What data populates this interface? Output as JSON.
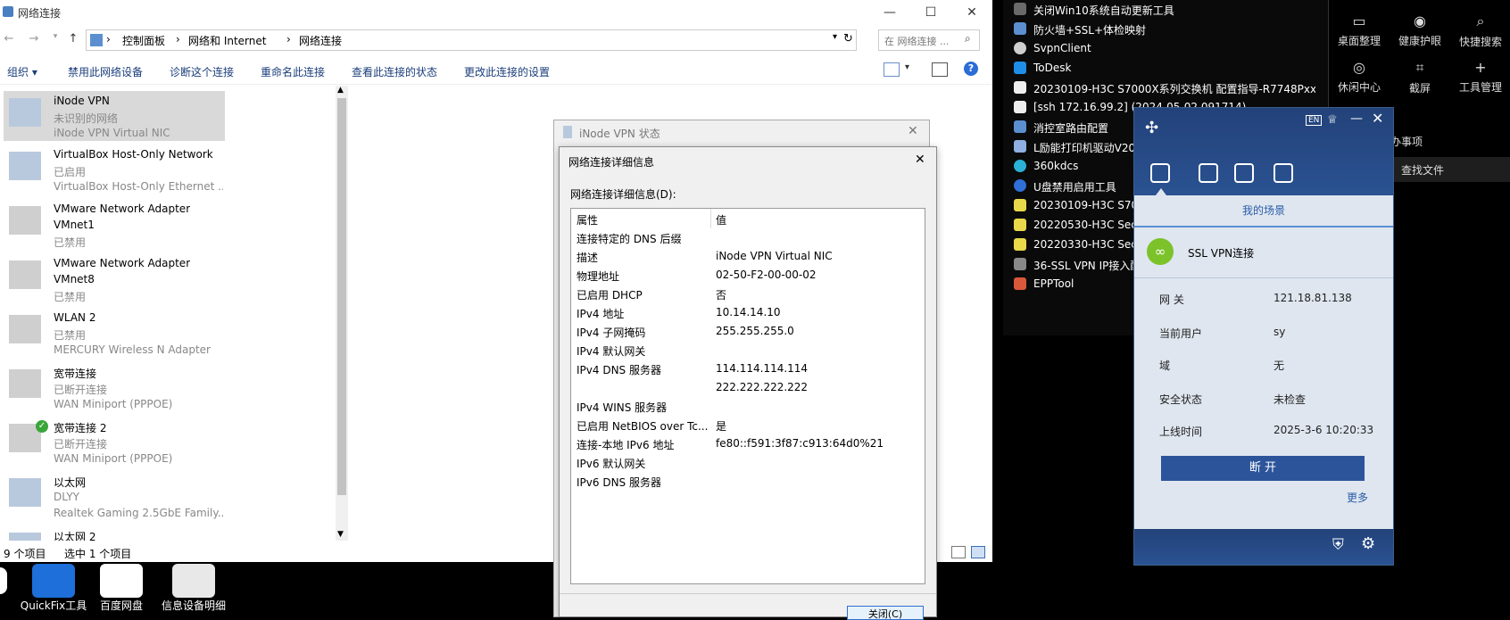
{
  "explorer": {
    "title": "网络连接",
    "breadcrumb": [
      "控制面板",
      "网络和 Internet",
      "网络连接"
    ],
    "search_placeholder": "在 网络连接 ...",
    "commands": [
      "组织 ▾",
      "禁用此网络设备",
      "诊断这个连接",
      "重命名此连接",
      "查看此连接的状态",
      "更改此连接的设置"
    ],
    "adapters": [
      {
        "name": "iNode VPN",
        "status": "未识别的网络",
        "device": "iNode VPN Virtual NIC"
      },
      {
        "name": "VirtualBox Host-Only Network",
        "status": "已启用",
        "device": "VirtualBox Host-Only Ethernet ..."
      },
      {
        "name": "VMware Network Adapter",
        "status": "VMnet1",
        "device": "已禁用"
      },
      {
        "name": "VMware Network Adapter",
        "status": "VMnet8",
        "device": "已禁用"
      },
      {
        "name": "WLAN 2",
        "status": "已禁用",
        "device": "MERCURY Wireless N Adapter"
      },
      {
        "name": "宽带连接",
        "status": "已断开连接",
        "device": "WAN Miniport (PPPOE)"
      },
      {
        "name": "宽带连接 2",
        "status": "已断开连接",
        "device": "WAN Miniport (PPPOE)"
      },
      {
        "name": "以太网",
        "status": "DLYY",
        "device": "Realtek Gaming 2.5GbE Family..."
      },
      {
        "name": "以太网 2",
        "status": "",
        "device": ""
      }
    ],
    "status_count": "9 个项目",
    "status_selected": "选中 1 个项目"
  },
  "taskbar": {
    "apps": [
      "QuickFix工具",
      "百度网盘",
      "信息设备明细"
    ]
  },
  "status_dialog": {
    "title": "iNode VPN 状态"
  },
  "detail_dialog": {
    "title": "网络连接详细信息",
    "label": "网络连接详细信息(D):",
    "col_prop": "属性",
    "col_val": "值",
    "rows": [
      {
        "k": "连接特定的 DNS 后缀",
        "v": ""
      },
      {
        "k": "描述",
        "v": "iNode VPN Virtual NIC"
      },
      {
        "k": "物理地址",
        "v": "02-50-F2-00-00-02"
      },
      {
        "k": "已启用 DHCP",
        "v": "否"
      },
      {
        "k": "IPv4 地址",
        "v": "10.14.14.10"
      },
      {
        "k": "IPv4 子网掩码",
        "v": "255.255.255.0"
      },
      {
        "k": "IPv4 默认网关",
        "v": ""
      },
      {
        "k": "IPv4 DNS 服务器",
        "v": "114.114.114.114"
      },
      {
        "k": "",
        "v": "222.222.222.222"
      },
      {
        "k": "IPv4 WINS 服务器",
        "v": ""
      },
      {
        "k": "已启用 NetBIOS over Tc...",
        "v": "是"
      },
      {
        "k": "连接-本地 IPv6 地址",
        "v": "fe80::f591:3f87:c913:64d0%21"
      },
      {
        "k": "IPv6 默认网关",
        "v": ""
      },
      {
        "k": "IPv6 DNS 服务器",
        "v": ""
      }
    ],
    "close_label": "关闭(C)"
  },
  "start_list": [
    "关闭Win10系统自动更新工具",
    "防火墙+SSL+体检映射",
    "SvpnClient",
    "ToDesk",
    "20230109-H3C S7000X系列交换机 配置指导-R7748Pxx-...",
    "[ssh 172.16.99.2] (2024-05-02 091714)",
    "消控室路由配置",
    "L励能打印机驱动V20",
    "360kdcs",
    "U盘禁用启用工具",
    "20230109-H3C S700",
    "20220530-H3C SecP",
    "20220330-H3C Seci",
    "36-SSL VPN IP接入配",
    "EPPTool"
  ],
  "quick_actions": {
    "row1": [
      "桌面整理",
      "健康护眼",
      "快捷搜索"
    ],
    "row2": [
      "休闲中心",
      "截屏",
      "工具管理"
    ],
    "side_a": "办事项",
    "side_b": "、查找文件"
  },
  "inode": {
    "lang": "EN",
    "scene_tab": "我的场景",
    "connection_name": "SSL VPN连接",
    "fields": [
      {
        "k": "网 关",
        "v": "121.18.81.138"
      },
      {
        "k": "当前用户",
        "v": "sy"
      },
      {
        "k": "域",
        "v": "无"
      },
      {
        "k": "安全状态",
        "v": "未检查"
      },
      {
        "k": "上线时间",
        "v": "2025-3-6 10:20:33"
      }
    ],
    "disconnect_label": "断 开",
    "more_label": "更多",
    "colors": {
      "header": "#23427a",
      "button": "#2b549a",
      "link": "#2a5ca8"
    }
  }
}
